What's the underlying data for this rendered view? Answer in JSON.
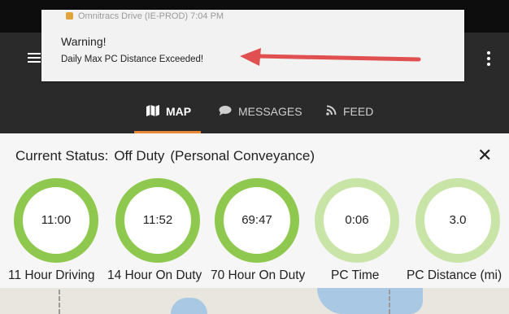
{
  "notification": {
    "app_line": "Omnitracs Drive (IE-PROD)  7:04 PM",
    "title": "Warning!",
    "body": "Daily Max PC Distance Exceeded!"
  },
  "tabs": [
    {
      "label": "MAP",
      "icon": "map-icon",
      "active": true
    },
    {
      "label": "MESSAGES",
      "icon": "chat-bubble-icon",
      "active": false
    },
    {
      "label": "FEED",
      "icon": "rss-icon",
      "active": false
    }
  ],
  "status": {
    "prefix": "Current Status:",
    "duty": "Off Duty",
    "mode": "(Personal Conveyance)"
  },
  "gauges": [
    {
      "value": "11:00",
      "label": "11 Hour Driving"
    },
    {
      "value": "11:52",
      "label": "14 Hour On Duty"
    },
    {
      "value": "69:47",
      "label": "70 Hour On Duty"
    },
    {
      "value": "0:06",
      "label": "PC Time"
    },
    {
      "value": "3.0",
      "label": "PC Distance (mi)"
    }
  ],
  "colors": {
    "accent_orange": "#e98834",
    "gauge_green": "#8fc84f",
    "gauge_light": "#c9e4a7",
    "arrow_red": "#e05050",
    "toolbar": "#2a2a2a"
  }
}
